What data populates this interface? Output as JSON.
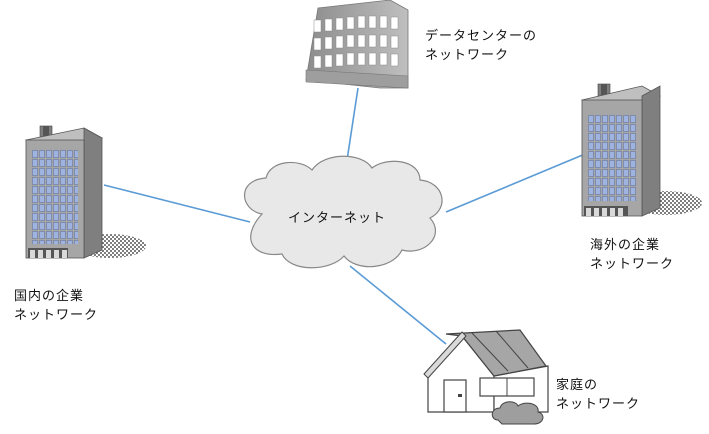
{
  "internet": {
    "label": "インターネット"
  },
  "datacenter": {
    "line1": "データセンターの",
    "line2": "ネットワーク"
  },
  "domestic": {
    "line1": "国内の企業",
    "line2": "ネットワーク"
  },
  "overseas": {
    "line1": "海外の企業",
    "line2": "ネットワーク"
  },
  "home": {
    "line1": "家庭の",
    "line2": "ネットワーク"
  },
  "colors": {
    "link": "#5b9bd5",
    "cloud_fill": "#e8e8e8",
    "cloud_stroke": "#888888",
    "building_side": "#7f7f7f",
    "building_front": "#a6a6a6",
    "window": "#9fb3e0",
    "shadow": "#aaaaaa"
  }
}
